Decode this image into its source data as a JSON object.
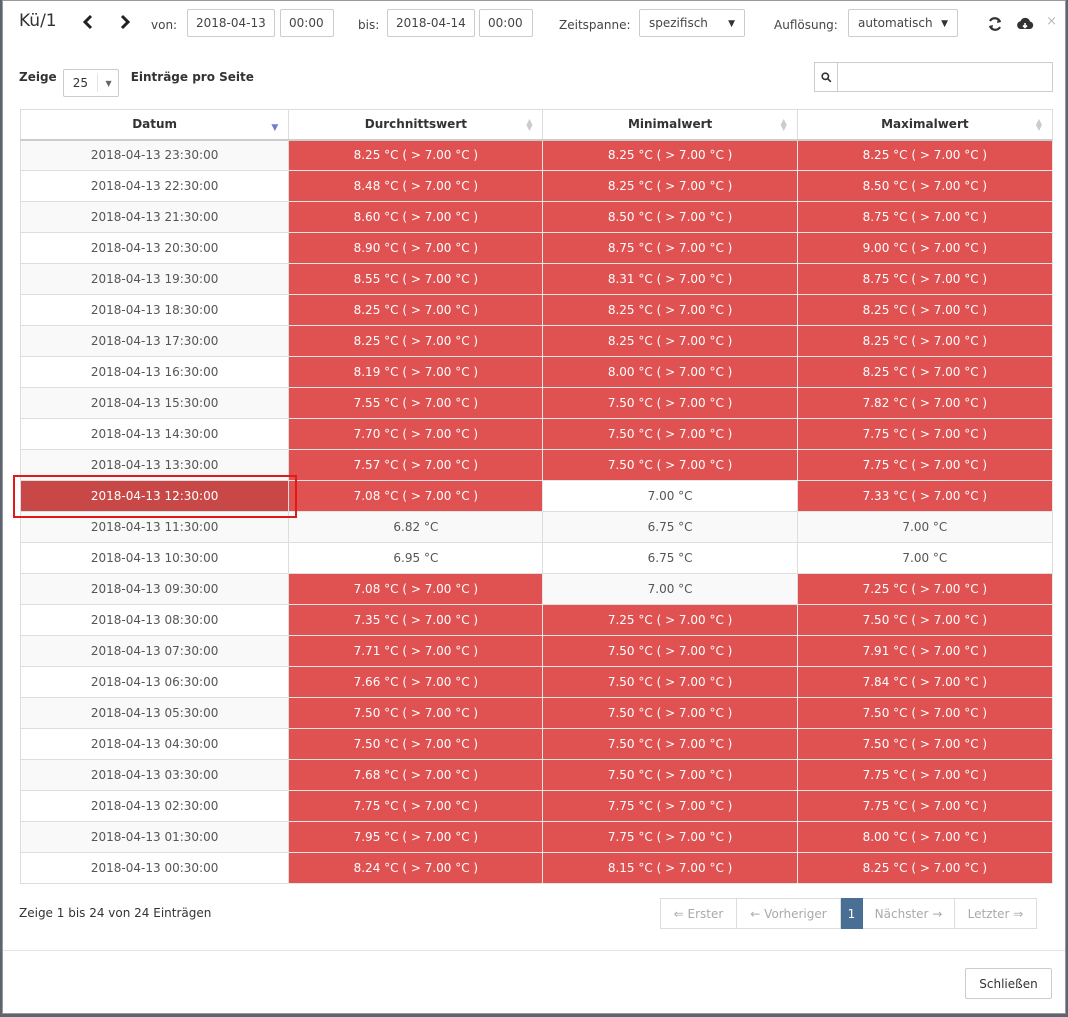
{
  "header": {
    "title": "Kü/1",
    "from_label": "von:",
    "from_date": "2018-04-13",
    "from_time": "00:00",
    "to_label": "bis:",
    "to_date": "2018-04-14",
    "to_time": "00:00",
    "span_label": "Zeitspanne:",
    "span_value": "spezifisch",
    "res_label": "Auflösung:",
    "res_value": "automatisch",
    "close_symbol": "×"
  },
  "controls": {
    "show_label": "Zeige",
    "page_size": "25",
    "per_page_label": "Einträge pro Seite",
    "search_placeholder": ""
  },
  "table": {
    "headers": [
      "Datum",
      "Durchnittswert",
      "Minimalwert",
      "Maximalwert"
    ],
    "rows": [
      {
        "datum": "2018-04-13 23:30:00",
        "avg": "8.25 °C ( > 7.00 °C )",
        "min": "8.25 °C ( > 7.00 °C )",
        "max": "8.25 °C ( > 7.00 °C )",
        "alerts": [
          1,
          1,
          1
        ]
      },
      {
        "datum": "2018-04-13 22:30:00",
        "avg": "8.48 °C ( > 7.00 °C )",
        "min": "8.25 °C ( > 7.00 °C )",
        "max": "8.50 °C ( > 7.00 °C )",
        "alerts": [
          1,
          1,
          1
        ]
      },
      {
        "datum": "2018-04-13 21:30:00",
        "avg": "8.60 °C ( > 7.00 °C )",
        "min": "8.50 °C ( > 7.00 °C )",
        "max": "8.75 °C ( > 7.00 °C )",
        "alerts": [
          1,
          1,
          1
        ]
      },
      {
        "datum": "2018-04-13 20:30:00",
        "avg": "8.90 °C ( > 7.00 °C )",
        "min": "8.75 °C ( > 7.00 °C )",
        "max": "9.00 °C ( > 7.00 °C )",
        "alerts": [
          1,
          1,
          1
        ]
      },
      {
        "datum": "2018-04-13 19:30:00",
        "avg": "8.55 °C ( > 7.00 °C )",
        "min": "8.31 °C ( > 7.00 °C )",
        "max": "8.75 °C ( > 7.00 °C )",
        "alerts": [
          1,
          1,
          1
        ]
      },
      {
        "datum": "2018-04-13 18:30:00",
        "avg": "8.25 °C ( > 7.00 °C )",
        "min": "8.25 °C ( > 7.00 °C )",
        "max": "8.25 °C ( > 7.00 °C )",
        "alerts": [
          1,
          1,
          1
        ]
      },
      {
        "datum": "2018-04-13 17:30:00",
        "avg": "8.25 °C ( > 7.00 °C )",
        "min": "8.25 °C ( > 7.00 °C )",
        "max": "8.25 °C ( > 7.00 °C )",
        "alerts": [
          1,
          1,
          1
        ]
      },
      {
        "datum": "2018-04-13 16:30:00",
        "avg": "8.19 °C ( > 7.00 °C )",
        "min": "8.00 °C ( > 7.00 °C )",
        "max": "8.25 °C ( > 7.00 °C )",
        "alerts": [
          1,
          1,
          1
        ]
      },
      {
        "datum": "2018-04-13 15:30:00",
        "avg": "7.55 °C ( > 7.00 °C )",
        "min": "7.50 °C ( > 7.00 °C )",
        "max": "7.82 °C ( > 7.00 °C )",
        "alerts": [
          1,
          1,
          1
        ]
      },
      {
        "datum": "2018-04-13 14:30:00",
        "avg": "7.70 °C ( > 7.00 °C )",
        "min": "7.50 °C ( > 7.00 °C )",
        "max": "7.75 °C ( > 7.00 °C )",
        "alerts": [
          1,
          1,
          1
        ]
      },
      {
        "datum": "2018-04-13 13:30:00",
        "avg": "7.57 °C ( > 7.00 °C )",
        "min": "7.50 °C ( > 7.00 °C )",
        "max": "7.75 °C ( > 7.00 °C )",
        "alerts": [
          1,
          1,
          1
        ]
      },
      {
        "datum": "2018-04-13 12:30:00",
        "avg": "7.08 °C ( > 7.00 °C )",
        "min": "7.00 °C",
        "max": "7.33 °C ( > 7.00 °C )",
        "alerts": [
          1,
          0,
          1
        ],
        "selected": true
      },
      {
        "datum": "2018-04-13 11:30:00",
        "avg": "6.82 °C",
        "min": "6.75 °C",
        "max": "7.00 °C",
        "alerts": [
          0,
          0,
          0
        ]
      },
      {
        "datum": "2018-04-13 10:30:00",
        "avg": "6.95 °C",
        "min": "6.75 °C",
        "max": "7.00 °C",
        "alerts": [
          0,
          0,
          0
        ]
      },
      {
        "datum": "2018-04-13 09:30:00",
        "avg": "7.08 °C ( > 7.00 °C )",
        "min": "7.00 °C",
        "max": "7.25 °C ( > 7.00 °C )",
        "alerts": [
          1,
          0,
          1
        ]
      },
      {
        "datum": "2018-04-13 08:30:00",
        "avg": "7.35 °C ( > 7.00 °C )",
        "min": "7.25 °C ( > 7.00 °C )",
        "max": "7.50 °C ( > 7.00 °C )",
        "alerts": [
          1,
          1,
          1
        ]
      },
      {
        "datum": "2018-04-13 07:30:00",
        "avg": "7.71 °C ( > 7.00 °C )",
        "min": "7.50 °C ( > 7.00 °C )",
        "max": "7.91 °C ( > 7.00 °C )",
        "alerts": [
          1,
          1,
          1
        ]
      },
      {
        "datum": "2018-04-13 06:30:00",
        "avg": "7.66 °C ( > 7.00 °C )",
        "min": "7.50 °C ( > 7.00 °C )",
        "max": "7.84 °C ( > 7.00 °C )",
        "alerts": [
          1,
          1,
          1
        ]
      },
      {
        "datum": "2018-04-13 05:30:00",
        "avg": "7.50 °C ( > 7.00 °C )",
        "min": "7.50 °C ( > 7.00 °C )",
        "max": "7.50 °C ( > 7.00 °C )",
        "alerts": [
          1,
          1,
          1
        ]
      },
      {
        "datum": "2018-04-13 04:30:00",
        "avg": "7.50 °C ( > 7.00 °C )",
        "min": "7.50 °C ( > 7.00 °C )",
        "max": "7.50 °C ( > 7.00 °C )",
        "alerts": [
          1,
          1,
          1
        ]
      },
      {
        "datum": "2018-04-13 03:30:00",
        "avg": "7.68 °C ( > 7.00 °C )",
        "min": "7.50 °C ( > 7.00 °C )",
        "max": "7.75 °C ( > 7.00 °C )",
        "alerts": [
          1,
          1,
          1
        ]
      },
      {
        "datum": "2018-04-13 02:30:00",
        "avg": "7.75 °C ( > 7.00 °C )",
        "min": "7.75 °C ( > 7.00 °C )",
        "max": "7.75 °C ( > 7.00 °C )",
        "alerts": [
          1,
          1,
          1
        ]
      },
      {
        "datum": "2018-04-13 01:30:00",
        "avg": "7.95 °C ( > 7.00 °C )",
        "min": "7.75 °C ( > 7.00 °C )",
        "max": "8.00 °C ( > 7.00 °C )",
        "alerts": [
          1,
          1,
          1
        ]
      },
      {
        "datum": "2018-04-13 00:30:00",
        "avg": "8.24 °C ( > 7.00 °C )",
        "min": "8.15 °C ( > 7.00 °C )",
        "max": "8.25 °C ( > 7.00 °C )",
        "alerts": [
          1,
          1,
          1
        ]
      }
    ]
  },
  "footer": {
    "info": "Zeige 1 bis 24 von 24 Einträgen",
    "pager": {
      "first": "⇐ Erster",
      "prev": "← Vorheriger",
      "current": "1",
      "next": "Nächster →",
      "last": "Letzter ⇒"
    },
    "close_button": "Schließen"
  },
  "colors": {
    "alert": "#e05252",
    "selected": "#c84848",
    "pager_active": "#4a6f95",
    "sort_active": "#6e7fd0"
  },
  "icons": {
    "prev": "chevron-left-icon",
    "next": "chevron-right-icon",
    "refresh": "refresh-icon",
    "download": "cloud-download-icon",
    "search": "search-icon",
    "close": "close-icon"
  }
}
